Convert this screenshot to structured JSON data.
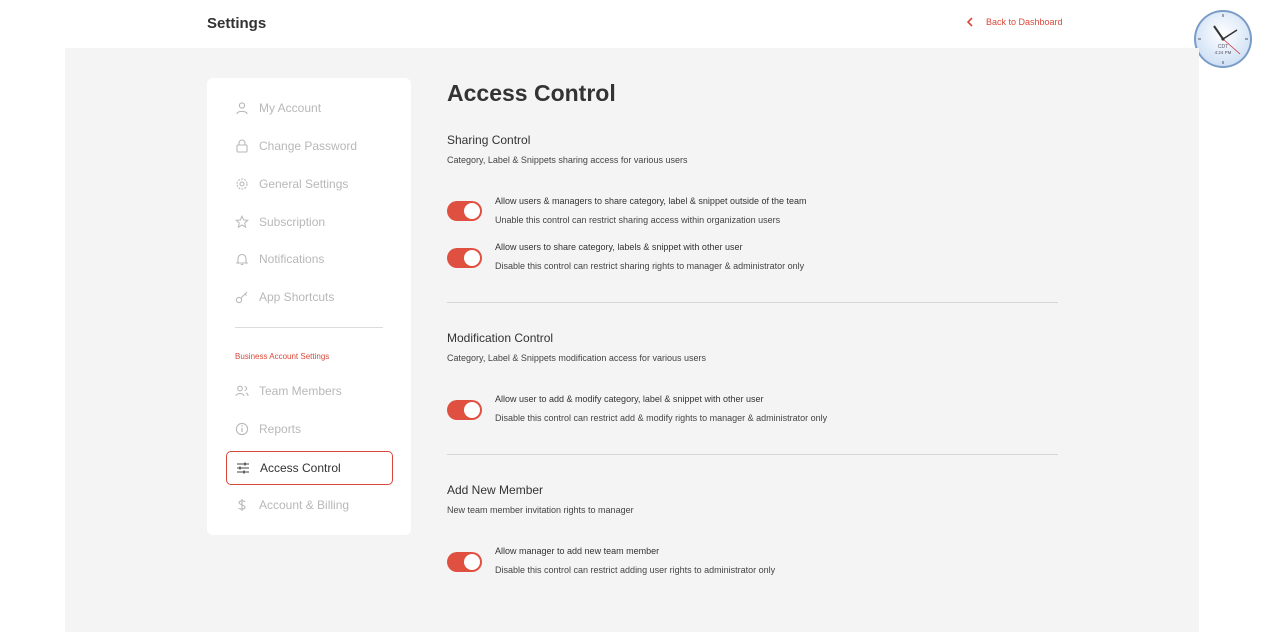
{
  "header": {
    "title": "Settings",
    "back_label": "Back to Dashboard"
  },
  "clock": {
    "line1": "CDT",
    "line2": "4:24 PM"
  },
  "sidebar": {
    "items": [
      {
        "label": "My Account",
        "icon": "user-icon"
      },
      {
        "label": "Change Password",
        "icon": "lock-icon"
      },
      {
        "label": "General Settings",
        "icon": "gear-icon"
      },
      {
        "label": "Subscription",
        "icon": "star-icon"
      },
      {
        "label": "Notifications",
        "icon": "bell-icon"
      },
      {
        "label": "App Shortcuts",
        "icon": "key-icon"
      }
    ],
    "section_label": "Business Account Settings",
    "business_items": [
      {
        "label": "Team Members",
        "icon": "users-icon"
      },
      {
        "label": "Reports",
        "icon": "info-icon"
      },
      {
        "label": "Access Control",
        "icon": "sliders-icon",
        "active": true
      },
      {
        "label": "Account & Billing",
        "icon": "dollar-icon"
      }
    ]
  },
  "main": {
    "title": "Access Control",
    "sections": [
      {
        "title": "Sharing Control",
        "subtitle": "Category, Label & Snippets sharing access for various users",
        "rows": [
          {
            "main": "Allow users & managers to share category, label & snippet outside of the team",
            "sub": "Unable this control can restrict sharing access within organization users",
            "on": true
          },
          {
            "main": "Allow users to share category, labels & snippet with other user",
            "sub": "Disable this control can restrict sharing rights to manager & administrator only",
            "on": true
          }
        ]
      },
      {
        "title": "Modification Control",
        "subtitle": "Category, Label & Snippets modification access for various users",
        "rows": [
          {
            "main": "Allow user to add & modify category, label & snippet with other user",
            "sub": "Disable this control can restrict add & modify rights to manager & administrator only",
            "on": true
          }
        ]
      },
      {
        "title": "Add New Member",
        "subtitle": "New team member invitation rights to manager",
        "rows": [
          {
            "main": "Allow manager to add new team member",
            "sub": "Disable this control can restrict adding user rights to administrator only",
            "on": true
          }
        ]
      }
    ]
  },
  "colors": {
    "accent": "#d9493a",
    "toggle_on": "#e05040",
    "background": "#f4f4f4"
  }
}
